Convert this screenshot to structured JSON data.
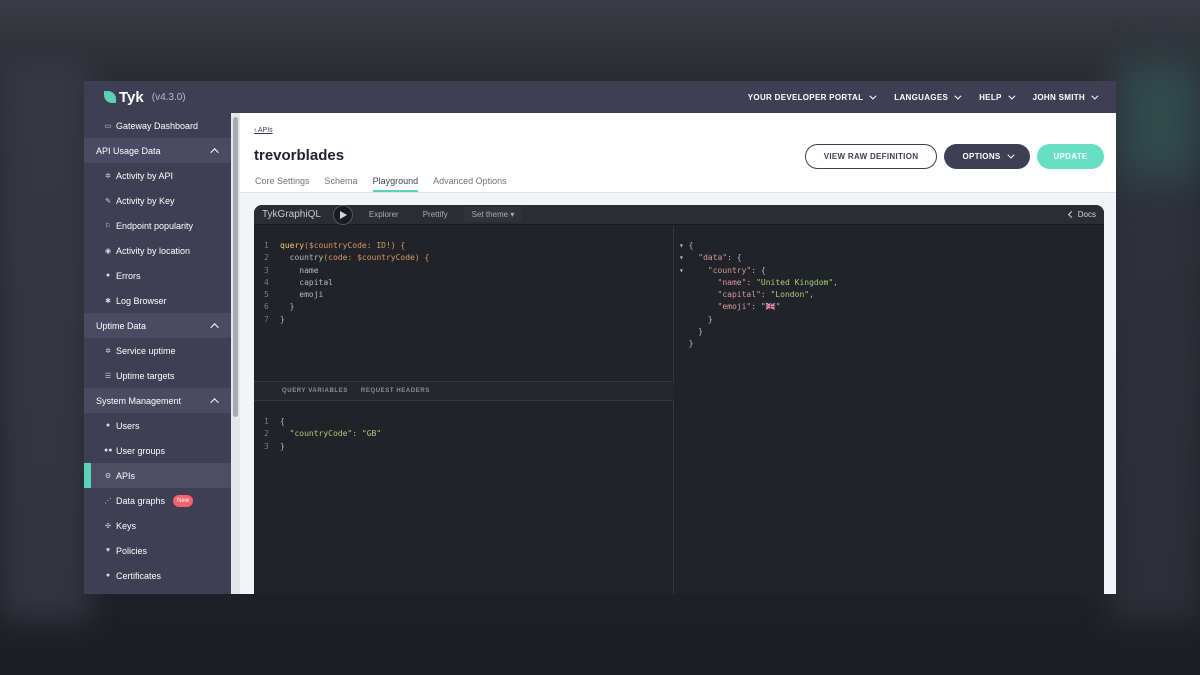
{
  "app": {
    "name": "Tyk",
    "version": "(v4.3.0)"
  },
  "topnav": [
    "YOUR DEVELOPER PORTAL",
    "LANGUAGES",
    "HELP",
    "JOHN SMITH"
  ],
  "sidebar": {
    "gateway": {
      "label": "Gateway Dashboard",
      "icon": "monitor-icon"
    },
    "api_usage": {
      "heading": "API Usage Data",
      "items": [
        {
          "label": "Activity by API",
          "icon": "activity-icon"
        },
        {
          "label": "Activity by Key",
          "icon": "key-icon"
        },
        {
          "label": "Endpoint popularity",
          "icon": "endpoint-icon"
        },
        {
          "label": "Activity by location",
          "icon": "globe-icon"
        },
        {
          "label": "Errors",
          "icon": "error-icon"
        },
        {
          "label": "Log Browser",
          "icon": "log-icon"
        }
      ]
    },
    "uptime": {
      "heading": "Uptime Data",
      "items": [
        {
          "label": "Service uptime",
          "icon": "uptime-icon"
        },
        {
          "label": "Uptime targets",
          "icon": "targets-icon"
        }
      ]
    },
    "system": {
      "heading": "System Management",
      "items": [
        {
          "label": "Users",
          "icon": "user-icon"
        },
        {
          "label": "User groups",
          "icon": "users-icon"
        },
        {
          "label": "APIs",
          "icon": "api-icon",
          "active": true
        },
        {
          "label": "Data graphs",
          "icon": "graph-icon",
          "badge": "New"
        },
        {
          "label": "Keys",
          "icon": "keys-icon"
        },
        {
          "label": "Policies",
          "icon": "policy-icon"
        },
        {
          "label": "Certificates",
          "icon": "certificate-icon"
        }
      ]
    }
  },
  "header": {
    "back_label": "APIs",
    "title": "trevorblades",
    "tabs": [
      "Core Settings",
      "Schema",
      "Playground",
      "Advanced Options"
    ],
    "active_tab": "Playground",
    "view_raw": "VIEW RAW DEFINITION",
    "options": "OPTIONS",
    "update": "UPDATE"
  },
  "graphiql": {
    "title": "TykGraphiQL",
    "explorer": "Explorer",
    "prettify": "Prettify",
    "set_theme": "Set theme",
    "docs": "Docs",
    "query_variables_tab": "QUERY VARIABLES",
    "request_headers_tab": "REQUEST HEADERS",
    "query_lines": [
      [
        "1",
        "query",
        "($countryCode: ID!) {"
      ],
      [
        "2",
        "  country",
        "(code: $countryCode) {"
      ],
      [
        "3",
        "    name",
        ""
      ],
      [
        "4",
        "    capital",
        ""
      ],
      [
        "5",
        "    emoji",
        ""
      ],
      [
        "6",
        "  }",
        ""
      ],
      [
        "7",
        "}",
        ""
      ]
    ],
    "variables_lines": [
      [
        "1",
        "{"
      ],
      [
        "2",
        "  \"countryCode\": \"GB\""
      ],
      [
        "3",
        "}"
      ]
    ],
    "result": {
      "name": "United Kingdom",
      "capital": "London",
      "emoji": "🇬🇧"
    }
  }
}
